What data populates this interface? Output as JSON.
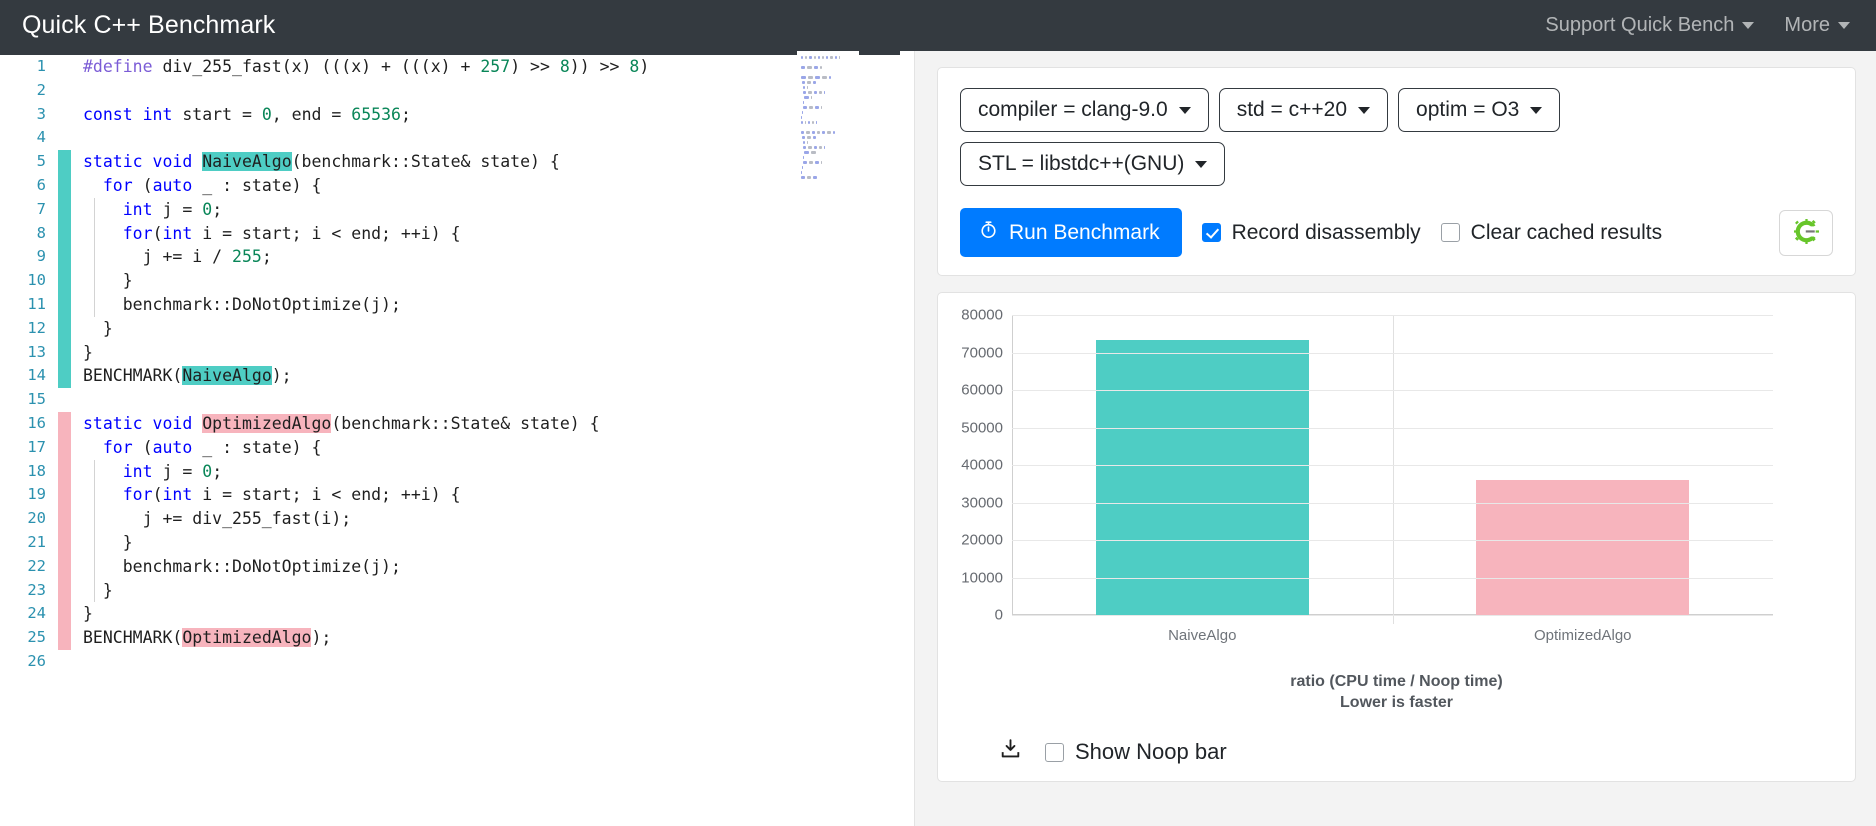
{
  "navbar": {
    "brand": "Quick C++ Benchmark",
    "links": [
      {
        "label": "Support Quick Bench",
        "icon": "chevron-down-icon"
      },
      {
        "label": "More",
        "icon": "chevron-down-icon"
      }
    ]
  },
  "editor": {
    "lines": [
      {
        "n": "1",
        "deco": "none",
        "tokens": [
          {
            "t": "#define ",
            "c": "pp"
          },
          {
            "t": "div_255_fast(x) (((x) + (((x) + ",
            "c": ""
          },
          {
            "t": "257",
            "c": "n"
          },
          {
            "t": ") >> ",
            "c": ""
          },
          {
            "t": "8",
            "c": "n"
          },
          {
            "t": ")) >> ",
            "c": ""
          },
          {
            "t": "8",
            "c": "n"
          },
          {
            "t": ")",
            "c": ""
          }
        ]
      },
      {
        "n": "2",
        "deco": "none",
        "tokens": []
      },
      {
        "n": "3",
        "deco": "none",
        "tokens": [
          {
            "t": "const ",
            "c": "k"
          },
          {
            "t": "int ",
            "c": "k"
          },
          {
            "t": "start = ",
            "c": ""
          },
          {
            "t": "0",
            "c": "n"
          },
          {
            "t": ", end = ",
            "c": ""
          },
          {
            "t": "65536",
            "c": "n"
          },
          {
            "t": ";",
            "c": ""
          }
        ]
      },
      {
        "n": "4",
        "deco": "none",
        "tokens": []
      },
      {
        "n": "5",
        "deco": "teal",
        "tokens": [
          {
            "t": "static ",
            "c": "k"
          },
          {
            "t": "void ",
            "c": "k"
          },
          {
            "t": "NaiveAlgo",
            "c": "hl-teal"
          },
          {
            "t": "(benchmark::State& state) {",
            "c": ""
          }
        ]
      },
      {
        "n": "6",
        "deco": "teal",
        "tokens": [
          {
            "t": "  ",
            "c": ""
          },
          {
            "t": "for ",
            "c": "k"
          },
          {
            "t": "(",
            "c": ""
          },
          {
            "t": "auto",
            "c": "k"
          },
          {
            "t": " _ : state) {",
            "c": ""
          }
        ]
      },
      {
        "n": "7",
        "deco": "teal",
        "guide": true,
        "tokens": [
          {
            "t": "    ",
            "c": ""
          },
          {
            "t": "int ",
            "c": "k"
          },
          {
            "t": "j = ",
            "c": ""
          },
          {
            "t": "0",
            "c": "n"
          },
          {
            "t": ";",
            "c": ""
          }
        ]
      },
      {
        "n": "8",
        "deco": "teal",
        "guide": true,
        "tokens": [
          {
            "t": "    ",
            "c": ""
          },
          {
            "t": "for",
            "c": "k"
          },
          {
            "t": "(",
            "c": ""
          },
          {
            "t": "int ",
            "c": "k"
          },
          {
            "t": "i = start; i < end; ++i) {",
            "c": ""
          }
        ]
      },
      {
        "n": "9",
        "deco": "teal",
        "guide": true,
        "tokens": [
          {
            "t": "      j += i / ",
            "c": ""
          },
          {
            "t": "255",
            "c": "n"
          },
          {
            "t": ";",
            "c": ""
          }
        ]
      },
      {
        "n": "10",
        "deco": "teal",
        "guide": true,
        "tokens": [
          {
            "t": "    }",
            "c": ""
          }
        ]
      },
      {
        "n": "11",
        "deco": "teal",
        "guide": true,
        "tokens": [
          {
            "t": "    benchmark::DoNotOptimize(j);",
            "c": ""
          }
        ]
      },
      {
        "n": "12",
        "deco": "teal",
        "tokens": [
          {
            "t": "  }",
            "c": ""
          }
        ]
      },
      {
        "n": "13",
        "deco": "teal",
        "tokens": [
          {
            "t": "}",
            "c": ""
          }
        ]
      },
      {
        "n": "14",
        "deco": "teal",
        "tokens": [
          {
            "t": "BENCHMARK(",
            "c": ""
          },
          {
            "t": "NaiveAlgo",
            "c": "hl-teal"
          },
          {
            "t": ");",
            "c": ""
          }
        ]
      },
      {
        "n": "15",
        "deco": "none",
        "tokens": []
      },
      {
        "n": "16",
        "deco": "pink",
        "tokens": [
          {
            "t": "static ",
            "c": "k"
          },
          {
            "t": "void ",
            "c": "k"
          },
          {
            "t": "OptimizedAlgo",
            "c": "hl-pink"
          },
          {
            "t": "(benchmark::State& state) {",
            "c": ""
          }
        ]
      },
      {
        "n": "17",
        "deco": "pink",
        "tokens": [
          {
            "t": "  ",
            "c": ""
          },
          {
            "t": "for ",
            "c": "k"
          },
          {
            "t": "(",
            "c": ""
          },
          {
            "t": "auto",
            "c": "k"
          },
          {
            "t": " _ : state) {",
            "c": ""
          }
        ]
      },
      {
        "n": "18",
        "deco": "pink",
        "guide": true,
        "tokens": [
          {
            "t": "    ",
            "c": ""
          },
          {
            "t": "int ",
            "c": "k"
          },
          {
            "t": "j = ",
            "c": ""
          },
          {
            "t": "0",
            "c": "n"
          },
          {
            "t": ";",
            "c": ""
          }
        ]
      },
      {
        "n": "19",
        "deco": "pink",
        "guide": true,
        "tokens": [
          {
            "t": "    ",
            "c": ""
          },
          {
            "t": "for",
            "c": "k"
          },
          {
            "t": "(",
            "c": ""
          },
          {
            "t": "int ",
            "c": "k"
          },
          {
            "t": "i = start; i < end; ++i) {",
            "c": ""
          }
        ]
      },
      {
        "n": "20",
        "deco": "pink",
        "guide": true,
        "tokens": [
          {
            "t": "      j += div_255_fast(i);",
            "c": ""
          }
        ]
      },
      {
        "n": "21",
        "deco": "pink",
        "guide": true,
        "tokens": [
          {
            "t": "    }",
            "c": ""
          }
        ]
      },
      {
        "n": "22",
        "deco": "pink",
        "guide": true,
        "tokens": [
          {
            "t": "    benchmark::DoNotOptimize(j);",
            "c": ""
          }
        ]
      },
      {
        "n": "23",
        "deco": "pink",
        "guide": true,
        "tokens": [
          {
            "t": "  }",
            "c": ""
          }
        ]
      },
      {
        "n": "24",
        "deco": "pink",
        "tokens": [
          {
            "t": "}",
            "c": ""
          }
        ]
      },
      {
        "n": "25",
        "deco": "pink",
        "tokens": [
          {
            "t": "BENCHMARK(",
            "c": ""
          },
          {
            "t": "OptimizedAlgo",
            "c": "hl-pink"
          },
          {
            "t": ");",
            "c": ""
          }
        ]
      },
      {
        "n": "26",
        "deco": "none",
        "tokens": []
      }
    ]
  },
  "controls": {
    "pills": [
      {
        "label": "compiler = clang-9.0",
        "icon": "chevron-down-icon"
      },
      {
        "label": "std = c++20",
        "icon": "chevron-down-icon"
      },
      {
        "label": "optim = O3",
        "icon": "chevron-down-icon"
      },
      {
        "label": "STL = libstdc++(GNU)",
        "icon": "chevron-down-icon"
      }
    ],
    "run_button": {
      "label": "Run Benchmark",
      "icon": "stopwatch-icon",
      "color": "#007bff"
    },
    "checkboxes": [
      {
        "label": "Record disassembly",
        "checked": true
      },
      {
        "label": "Clear cached results",
        "checked": false
      }
    ],
    "asm_button_icon": "compiler-explorer-gear-icon"
  },
  "chart_data": {
    "type": "bar",
    "title": "",
    "categories": [
      "NaiveAlgo",
      "OptimizedAlgo"
    ],
    "values": [
      73300,
      36000
    ],
    "colors": [
      "#4ecdc4",
      "#f7b4bd"
    ],
    "xlabel": "",
    "ylabel": "",
    "ylim": [
      0,
      80000
    ],
    "yticks": [
      80000,
      70000,
      60000,
      50000,
      40000,
      30000,
      20000,
      10000,
      0
    ],
    "ytick_labels": [
      "80000",
      "70000",
      "60000",
      "50000",
      "40000",
      "30000",
      "20000",
      "10000",
      "0"
    ],
    "grid": true,
    "legend": "none",
    "caption_line1": "ratio (CPU time / Noop time)",
    "caption_line2": "Lower is faster"
  },
  "chart_footer": {
    "download_icon": "download-icon",
    "noop_checkbox": {
      "label": "Show Noop bar",
      "checked": false
    }
  }
}
